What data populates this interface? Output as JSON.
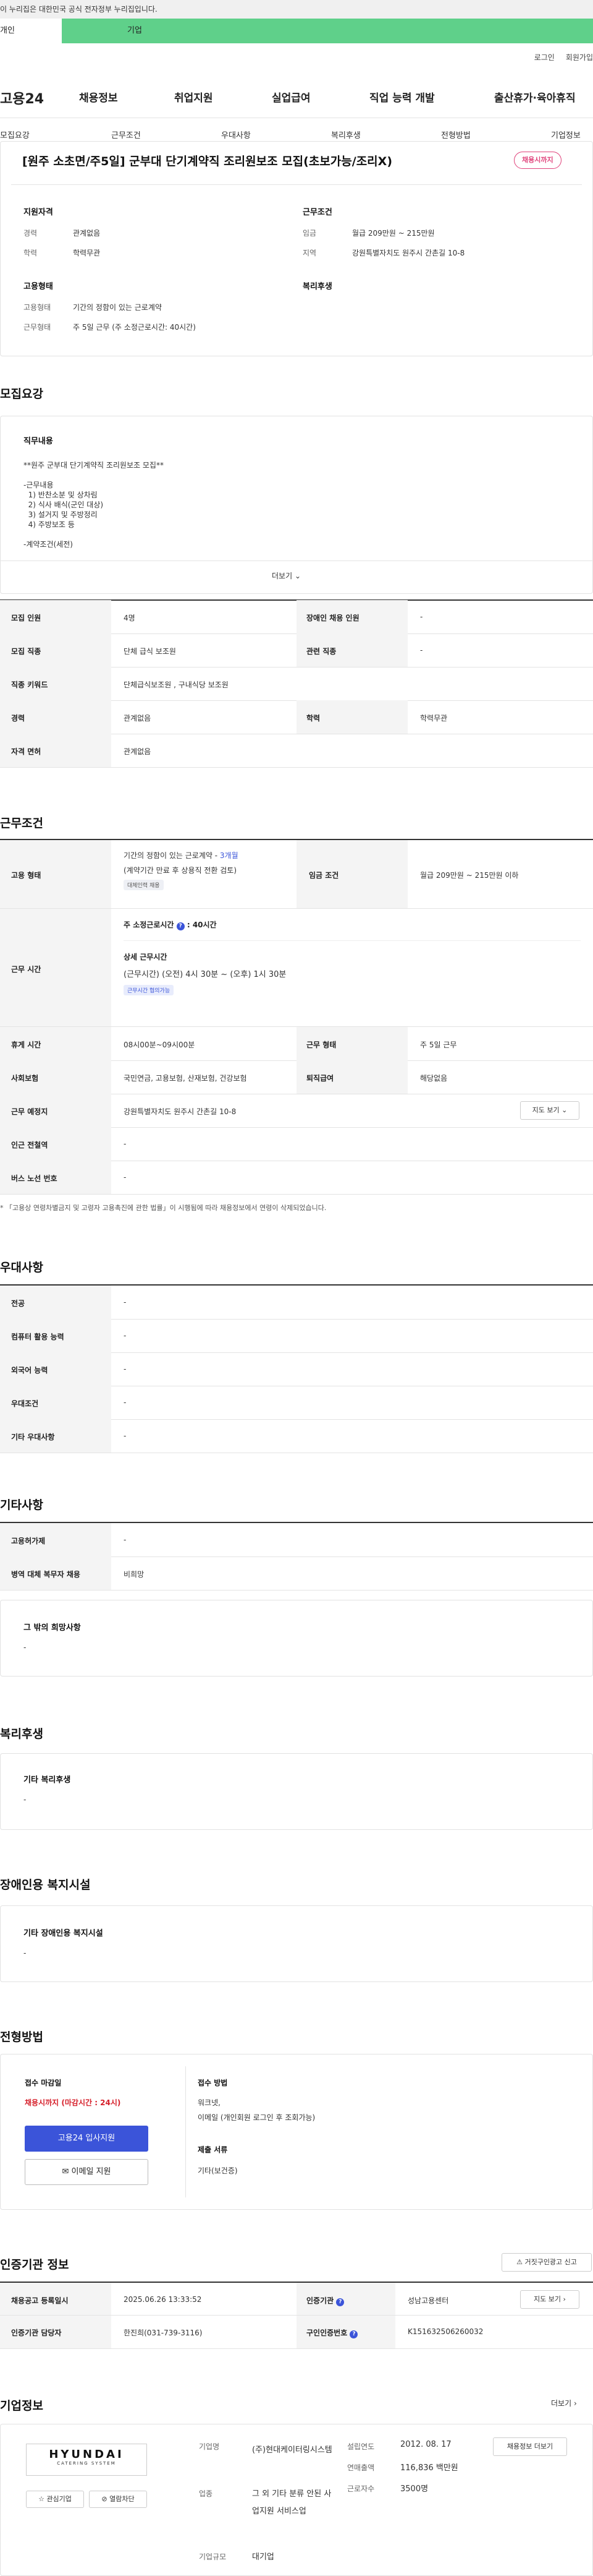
{
  "gov_banner": "이 누리집은 대한민국 공식 전자정부 누리집입니다.",
  "top_tabs": {
    "person": "개인",
    "business": "기업"
  },
  "util": {
    "login": "로그인",
    "join": "회원가입"
  },
  "logo": "고용24",
  "gnb": [
    "채용정보",
    "취업지원",
    "실업급여",
    "직업 능력 개발",
    "출산휴가·육아휴직"
  ],
  "snb": [
    "모집요강",
    "근무조건",
    "우대사항",
    "복리후생",
    "전형방법",
    "기업정보"
  ],
  "job": {
    "title": "[원주 소초면/주5일] 군부대 단기계약직 조리원보조 모집(초보가능/조리X)",
    "badge": "채용시까지"
  },
  "summary": {
    "qual_title": "지원자격",
    "career_k": "경력",
    "career_v": "관계없음",
    "edu_k": "학력",
    "edu_v": "학력무관",
    "cond_title": "근무조건",
    "wage_k": "임금",
    "wage_v": "월급 209만원 ~ 215만원",
    "area_k": "지역",
    "area_v": "강원특별자치도 원주시 간촌길 10-8",
    "emp_title": "고용형태",
    "emptype_k": "고용형태",
    "emptype_v": "기간의 정함이 있는 근로계약",
    "worktype_k": "근무형태",
    "worktype_v": "주 5일 근무 (주 소정근로시간: 40시간)",
    "welfare_title": "복리후생"
  },
  "recruit": {
    "section": "모집요강",
    "duty_title": "직무내용",
    "duty_lines": [
      "**원주 군부대 단기계약직 조리원보조 모집**",
      "",
      "-근무내용",
      "  1) 반찬소분 및 상차림",
      "  2) 식사 배식(군인 대상)",
      "  3) 설거지 및 주방정리",
      "  4) 주방보조 등",
      "",
      "-계약조건(세전)"
    ],
    "more": "더보기",
    "rows": [
      {
        "k1": "모집 인원",
        "v1": "4명",
        "k2": "장애인 채용 인원",
        "v2": "-"
      },
      {
        "k1": "모집 직종",
        "v1": "단체 급식 보조원",
        "k2": "관련 직종",
        "v2": "-"
      },
      {
        "k1": "직종 키워드",
        "v1": "단체급식보조원 , 구내식당 보조원"
      },
      {
        "k1": "경력",
        "v1": "관계없음",
        "k2": "학력",
        "v2": "학력무관"
      },
      {
        "k1": "자격 면허",
        "v1": "관계없음"
      }
    ]
  },
  "work": {
    "section": "근무조건",
    "emp_k": "고용 형태",
    "emp_v1": "기간의 정함이 있는 근로계약 - ",
    "emp_v1b": "3개월",
    "emp_v2": "(계약기간 만료 후 상용직 전환 검토)",
    "emp_chip": "대체인력 채용",
    "wage_k": "임금 조건",
    "wage_v": "월급 209만원 ~ 215만원 이하",
    "time_k": "근무 시간",
    "hours_title": "주 소정근로시간",
    "hours_v": "40시간",
    "detail_title": "상세 근무시간",
    "detail_v": "(근무시간) (오전) 4시 30분 ~ (오후) 1시 30분",
    "time_chip": "근무시간 협의가능",
    "rest_k": "휴게 시간",
    "rest_v": "08시00분~09시00분",
    "form_k": "근무 형태",
    "form_v": "주 5일 근무",
    "ins_k": "사회보험",
    "ins_v": "국민연금, 고용보험, 산재보험, 건강보험",
    "sev_k": "퇴직급여",
    "sev_v": "해당없음",
    "place_k": "근무 예정지",
    "place_v": "강원특별자치도 원주시 간촌길 10-8",
    "map_btn": "지도 보기",
    "subway_k": "인근 전철역",
    "subway_v": "-",
    "bus_k": "버스 노선 번호",
    "bus_v": "-",
    "notice": "* 「고용상 연령차별금지 및 고령자 고용촉진에 관한 법률」이 시행됨에 따라 채용정보에서 연령이 삭제되었습니다."
  },
  "pref": {
    "section": "우대사항",
    "rows": [
      {
        "k": "전공",
        "v": "-"
      },
      {
        "k": "컴퓨터 활용 능력",
        "v": "-"
      },
      {
        "k": "외국어 능력",
        "v": "-"
      },
      {
        "k": "우대조건",
        "v": "-"
      },
      {
        "k": "기타 우대사항",
        "v": "-"
      }
    ]
  },
  "etc": {
    "section": "기타사항",
    "rows": [
      {
        "k": "고용허가제",
        "v": "-"
      },
      {
        "k": "병역 대체 복무자 채용",
        "v": "비희망"
      }
    ],
    "other_title": "그 밖의 희망사항",
    "other_v": "-"
  },
  "welfare": {
    "section": "복리후생",
    "title": "기타 복리후생",
    "v": "-"
  },
  "disabled": {
    "section": "장애인용 복지시설",
    "title": "기타 장애인용 복지시설",
    "v": "-"
  },
  "apply": {
    "section": "전형방법",
    "deadline_title": "접수 마감일",
    "deadline_v": "채용시까지 (마감시간 : 24시)",
    "apply_btn": "고용24 입사지원",
    "email_btn": "이메일 지원",
    "method_title": "접수 방법",
    "method_v1": "워크넷,",
    "method_v2": "이메일 (개인회원 로그인 후 조회가능)",
    "doc_title": "제출 서류",
    "doc_v": "기타(보건증)"
  },
  "cert": {
    "section": "인증기관 정보",
    "report_btn": "거짓구인광고 신고",
    "reg_k": "채용공고 등록일시",
    "reg_v": "2025.06.26 13:33:52",
    "org_k": "인증기관",
    "org_v": "성남고용센터",
    "map_btn": "지도 보기",
    "mgr_k": "인증기관 담당자",
    "mgr_v": "한진희(031-739-3116)",
    "num_k": "구인인증번호",
    "num_v": "K151632506260032"
  },
  "company": {
    "section": "기업정보",
    "more": "더보기",
    "logo_main": "HYUNDAI",
    "logo_sub": "CATERING SYSTEM",
    "fav_btn": "관심기업",
    "block_btn": "열람차단",
    "name_k": "기업명",
    "name_v": "(주)현대케이터링시스템",
    "ind_k": "업종",
    "ind_v": "그 외 기타 분류 안된 사업지원 서비스업",
    "size_k": "기업규모",
    "size_v": "대기업",
    "est_k": "설립연도",
    "est_v": "2012. 08. 17",
    "sales_k": "연매출액",
    "sales_v": "116,836 백만원",
    "emp_k": "근로자수",
    "emp_v": "3500명",
    "info_btn": "채용정보 더보기"
  },
  "colors": {
    "biz_tab": "#5fd08a",
    "accent_blue": "#3b54d9",
    "badge_pink": "#e0447c",
    "deadline_red": "#d6202b"
  }
}
